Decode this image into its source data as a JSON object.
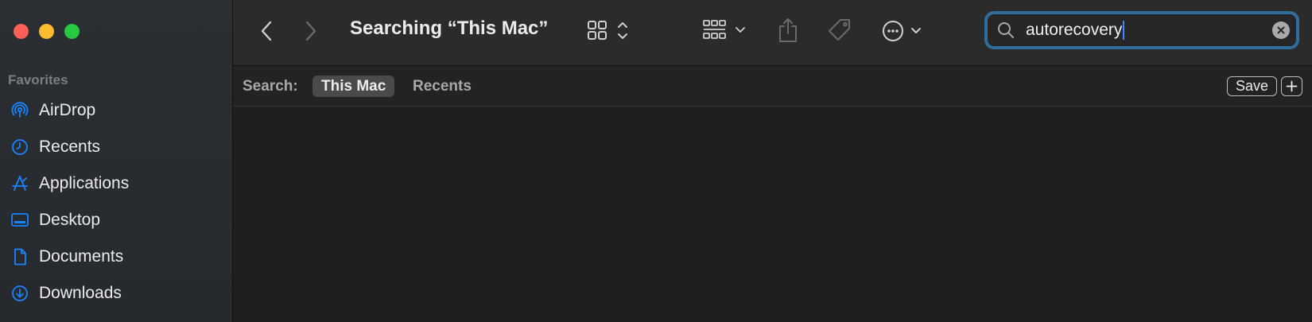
{
  "window": {
    "title": "Searching “This Mac”"
  },
  "sidebar": {
    "section_title": "Favorites",
    "items": [
      {
        "label": "AirDrop",
        "icon": "airdrop-icon"
      },
      {
        "label": "Recents",
        "icon": "clock-icon"
      },
      {
        "label": "Applications",
        "icon": "applications-icon"
      },
      {
        "label": "Desktop",
        "icon": "desktop-icon"
      },
      {
        "label": "Documents",
        "icon": "document-icon"
      },
      {
        "label": "Downloads",
        "icon": "download-icon"
      }
    ]
  },
  "search": {
    "value": "autorecovery"
  },
  "scope": {
    "label": "Search:",
    "this_mac": "This Mac",
    "recents": "Recents",
    "save": "Save"
  },
  "colors": {
    "accent": "#1a84ff",
    "focus_ring": "#2f6d9d",
    "close": "#fe5f57",
    "minimize": "#febc2e",
    "maximize": "#28c840"
  }
}
